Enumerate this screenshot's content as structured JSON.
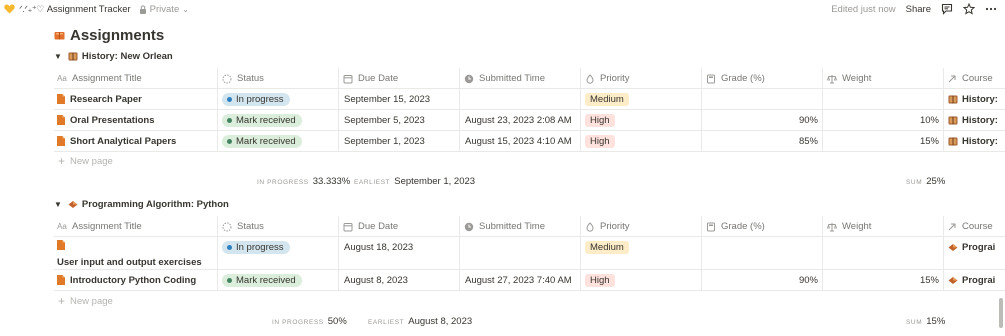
{
  "topbar": {
    "kaomoji": "ᐟ.ᐟ₊⁺♡",
    "title": "Assignment Tracker",
    "privacy": "Private",
    "edited": "Edited just now",
    "share": "Share"
  },
  "page": {
    "title": "Assignments"
  },
  "columns": [
    "Assignment Title",
    "Status",
    "Due Date",
    "Submitted Time",
    "Priority",
    "Grade (%)",
    "Weight",
    "Course"
  ],
  "groups": [
    {
      "title": "History: New Orlean",
      "rows": [
        {
          "title": "Research Paper",
          "status": "In progress",
          "status_color": "blue",
          "due": "September 15, 2023",
          "submitted": "",
          "priority": "Medium",
          "priority_color": "yellow",
          "grade": "",
          "weight": "",
          "course": "History:"
        },
        {
          "title": "Oral Presentations",
          "status": "Mark received",
          "status_color": "green",
          "due": "September 5, 2023",
          "submitted": "August 23, 2023 2:08 AM",
          "priority": "High",
          "priority_color": "red",
          "grade": "90%",
          "weight": "10%",
          "course": "History:"
        },
        {
          "title": "Short Analytical Papers",
          "status": "Mark received",
          "status_color": "green",
          "due": "September 1, 2023",
          "submitted": "August 15, 2023 4:10 AM",
          "priority": "High",
          "priority_color": "red",
          "grade": "85%",
          "weight": "15%",
          "course": "History:"
        }
      ],
      "new_page": "New page",
      "calc": {
        "status_label": "IN PROGRESS",
        "status_value": "33.333%",
        "due_label": "EARLIEST",
        "due_value": "September 1, 2023",
        "weight_label": "SUM",
        "weight_value": "25%"
      }
    },
    {
      "title": "Programming Algorithm: Python",
      "rows": [
        {
          "title": "User input and output exercises",
          "status": "In progress",
          "status_color": "blue",
          "due": "August 18, 2023",
          "submitted": "",
          "priority": "Medium",
          "priority_color": "yellow",
          "grade": "",
          "weight": "",
          "course": "Prograi"
        },
        {
          "title": "Introductory Python Coding",
          "status": "Mark received",
          "status_color": "green",
          "due": "August 8, 2023",
          "submitted": "August 27, 2023 7:40 AM",
          "priority": "High",
          "priority_color": "red",
          "grade": "90%",
          "weight": "15%",
          "course": "Prograi"
        }
      ],
      "new_page": "New page",
      "calc": {
        "status_label": "IN PROGRESS",
        "status_value": "50%",
        "due_label": "EARLIEST",
        "due_value": "August 8, 2023",
        "weight_label": "SUM",
        "weight_value": "15%"
      }
    }
  ],
  "icons": {
    "heart": "heart-icon",
    "lock": "lock-icon",
    "comment": "comment-icon",
    "star": "star-icon",
    "more": "more-icon",
    "page": "doc-icon",
    "book": "book-icon",
    "python": "course-icon"
  },
  "colors": {
    "blue_pill": "#d3e5ef",
    "green_pill": "#dbeddb",
    "yellow_tag": "#fdecc8",
    "red_tag": "#ffe2dd",
    "doc_icon": "#e07a28"
  }
}
